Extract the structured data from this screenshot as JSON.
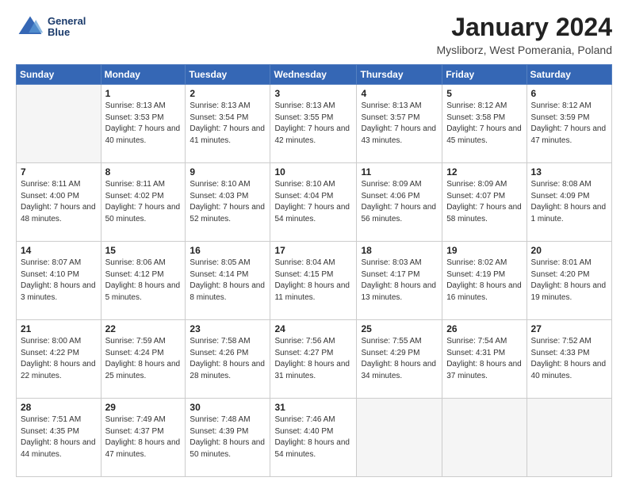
{
  "header": {
    "logo_line1": "General",
    "logo_line2": "Blue",
    "month_title": "January 2024",
    "location": "Mysliborz, West Pomerania, Poland"
  },
  "weekdays": [
    "Sunday",
    "Monday",
    "Tuesday",
    "Wednesday",
    "Thursday",
    "Friday",
    "Saturday"
  ],
  "weeks": [
    [
      {
        "day": "",
        "empty": true
      },
      {
        "day": "1",
        "sunrise": "Sunrise: 8:13 AM",
        "sunset": "Sunset: 3:53 PM",
        "daylight": "Daylight: 7 hours and 40 minutes."
      },
      {
        "day": "2",
        "sunrise": "Sunrise: 8:13 AM",
        "sunset": "Sunset: 3:54 PM",
        "daylight": "Daylight: 7 hours and 41 minutes."
      },
      {
        "day": "3",
        "sunrise": "Sunrise: 8:13 AM",
        "sunset": "Sunset: 3:55 PM",
        "daylight": "Daylight: 7 hours and 42 minutes."
      },
      {
        "day": "4",
        "sunrise": "Sunrise: 8:13 AM",
        "sunset": "Sunset: 3:57 PM",
        "daylight": "Daylight: 7 hours and 43 minutes."
      },
      {
        "day": "5",
        "sunrise": "Sunrise: 8:12 AM",
        "sunset": "Sunset: 3:58 PM",
        "daylight": "Daylight: 7 hours and 45 minutes."
      },
      {
        "day": "6",
        "sunrise": "Sunrise: 8:12 AM",
        "sunset": "Sunset: 3:59 PM",
        "daylight": "Daylight: 7 hours and 47 minutes."
      }
    ],
    [
      {
        "day": "7",
        "sunrise": "Sunrise: 8:11 AM",
        "sunset": "Sunset: 4:00 PM",
        "daylight": "Daylight: 7 hours and 48 minutes."
      },
      {
        "day": "8",
        "sunrise": "Sunrise: 8:11 AM",
        "sunset": "Sunset: 4:02 PM",
        "daylight": "Daylight: 7 hours and 50 minutes."
      },
      {
        "day": "9",
        "sunrise": "Sunrise: 8:10 AM",
        "sunset": "Sunset: 4:03 PM",
        "daylight": "Daylight: 7 hours and 52 minutes."
      },
      {
        "day": "10",
        "sunrise": "Sunrise: 8:10 AM",
        "sunset": "Sunset: 4:04 PM",
        "daylight": "Daylight: 7 hours and 54 minutes."
      },
      {
        "day": "11",
        "sunrise": "Sunrise: 8:09 AM",
        "sunset": "Sunset: 4:06 PM",
        "daylight": "Daylight: 7 hours and 56 minutes."
      },
      {
        "day": "12",
        "sunrise": "Sunrise: 8:09 AM",
        "sunset": "Sunset: 4:07 PM",
        "daylight": "Daylight: 7 hours and 58 minutes."
      },
      {
        "day": "13",
        "sunrise": "Sunrise: 8:08 AM",
        "sunset": "Sunset: 4:09 PM",
        "daylight": "Daylight: 8 hours and 1 minute."
      }
    ],
    [
      {
        "day": "14",
        "sunrise": "Sunrise: 8:07 AM",
        "sunset": "Sunset: 4:10 PM",
        "daylight": "Daylight: 8 hours and 3 minutes."
      },
      {
        "day": "15",
        "sunrise": "Sunrise: 8:06 AM",
        "sunset": "Sunset: 4:12 PM",
        "daylight": "Daylight: 8 hours and 5 minutes."
      },
      {
        "day": "16",
        "sunrise": "Sunrise: 8:05 AM",
        "sunset": "Sunset: 4:14 PM",
        "daylight": "Daylight: 8 hours and 8 minutes."
      },
      {
        "day": "17",
        "sunrise": "Sunrise: 8:04 AM",
        "sunset": "Sunset: 4:15 PM",
        "daylight": "Daylight: 8 hours and 11 minutes."
      },
      {
        "day": "18",
        "sunrise": "Sunrise: 8:03 AM",
        "sunset": "Sunset: 4:17 PM",
        "daylight": "Daylight: 8 hours and 13 minutes."
      },
      {
        "day": "19",
        "sunrise": "Sunrise: 8:02 AM",
        "sunset": "Sunset: 4:19 PM",
        "daylight": "Daylight: 8 hours and 16 minutes."
      },
      {
        "day": "20",
        "sunrise": "Sunrise: 8:01 AM",
        "sunset": "Sunset: 4:20 PM",
        "daylight": "Daylight: 8 hours and 19 minutes."
      }
    ],
    [
      {
        "day": "21",
        "sunrise": "Sunrise: 8:00 AM",
        "sunset": "Sunset: 4:22 PM",
        "daylight": "Daylight: 8 hours and 22 minutes."
      },
      {
        "day": "22",
        "sunrise": "Sunrise: 7:59 AM",
        "sunset": "Sunset: 4:24 PM",
        "daylight": "Daylight: 8 hours and 25 minutes."
      },
      {
        "day": "23",
        "sunrise": "Sunrise: 7:58 AM",
        "sunset": "Sunset: 4:26 PM",
        "daylight": "Daylight: 8 hours and 28 minutes."
      },
      {
        "day": "24",
        "sunrise": "Sunrise: 7:56 AM",
        "sunset": "Sunset: 4:27 PM",
        "daylight": "Daylight: 8 hours and 31 minutes."
      },
      {
        "day": "25",
        "sunrise": "Sunrise: 7:55 AM",
        "sunset": "Sunset: 4:29 PM",
        "daylight": "Daylight: 8 hours and 34 minutes."
      },
      {
        "day": "26",
        "sunrise": "Sunrise: 7:54 AM",
        "sunset": "Sunset: 4:31 PM",
        "daylight": "Daylight: 8 hours and 37 minutes."
      },
      {
        "day": "27",
        "sunrise": "Sunrise: 7:52 AM",
        "sunset": "Sunset: 4:33 PM",
        "daylight": "Daylight: 8 hours and 40 minutes."
      }
    ],
    [
      {
        "day": "28",
        "sunrise": "Sunrise: 7:51 AM",
        "sunset": "Sunset: 4:35 PM",
        "daylight": "Daylight: 8 hours and 44 minutes."
      },
      {
        "day": "29",
        "sunrise": "Sunrise: 7:49 AM",
        "sunset": "Sunset: 4:37 PM",
        "daylight": "Daylight: 8 hours and 47 minutes."
      },
      {
        "day": "30",
        "sunrise": "Sunrise: 7:48 AM",
        "sunset": "Sunset: 4:39 PM",
        "daylight": "Daylight: 8 hours and 50 minutes."
      },
      {
        "day": "31",
        "sunrise": "Sunrise: 7:46 AM",
        "sunset": "Sunset: 4:40 PM",
        "daylight": "Daylight: 8 hours and 54 minutes."
      },
      {
        "day": "",
        "empty": true
      },
      {
        "day": "",
        "empty": true
      },
      {
        "day": "",
        "empty": true
      }
    ]
  ]
}
